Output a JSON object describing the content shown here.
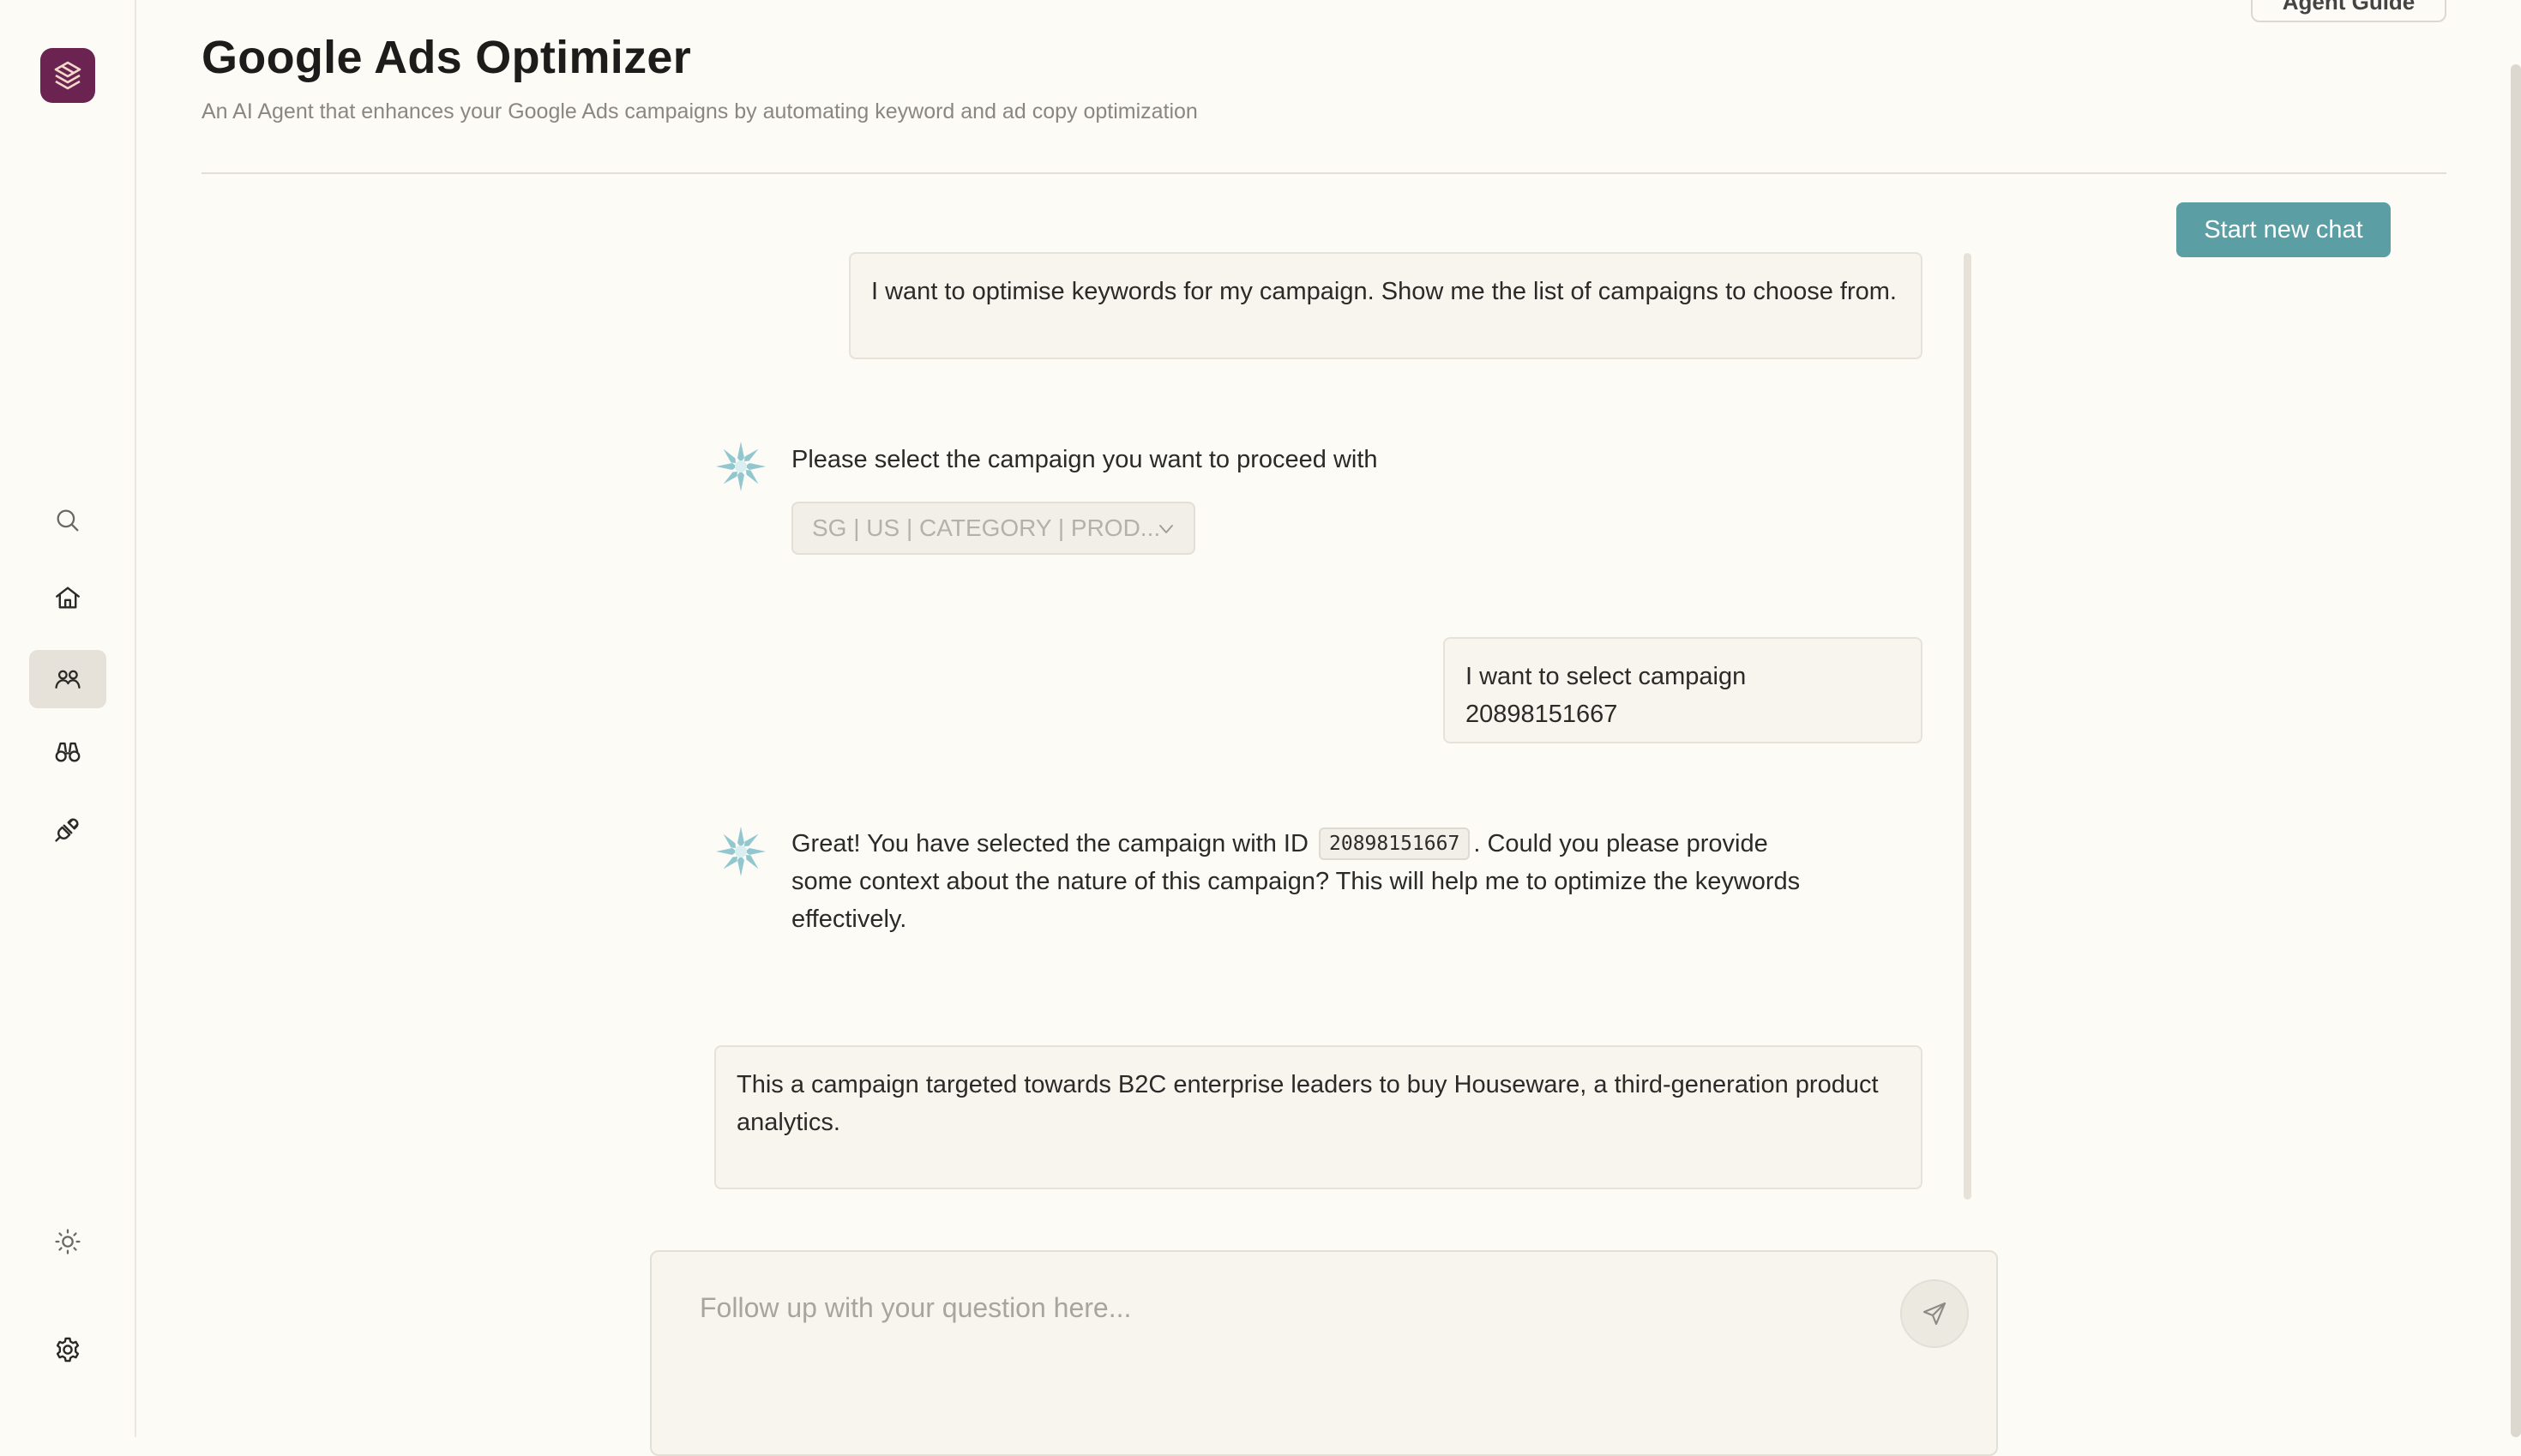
{
  "header": {
    "title": "Google Ads Optimizer",
    "subtitle": "An AI Agent that enhances your Google Ads campaigns by automating keyword and ad copy optimization",
    "agent_guide_label": "Agent Guide"
  },
  "toolbar": {
    "start_new_chat_label": "Start new chat"
  },
  "sidebar": {
    "items": [
      {
        "icon": "search-icon",
        "active": false
      },
      {
        "icon": "home-icon",
        "active": false
      },
      {
        "icon": "agents-icon",
        "active": true
      },
      {
        "icon": "binoculars-icon",
        "active": false
      },
      {
        "icon": "plug-icon",
        "active": false
      },
      {
        "icon": "sun-icon",
        "active": false
      },
      {
        "icon": "gear-icon",
        "active": false
      }
    ]
  },
  "chat": {
    "messages": [
      {
        "role": "user",
        "text": "I want to optimise keywords for my campaign. Show me the list of campaigns to choose from."
      },
      {
        "role": "assistant",
        "text": "Please select the campaign you want to proceed with",
        "select_value": "SG | US | CATEGORY | PROD..."
      },
      {
        "role": "user",
        "text": "I want to select campaign 20898151667"
      },
      {
        "role": "assistant",
        "text_before": "Great! You have selected the campaign with ID",
        "code": "20898151667",
        "text_after": ". Could you please provide some context about the nature of this campaign? This will help me to optimize the keywords effectively."
      },
      {
        "role": "user",
        "text": "This a campaign targeted towards B2C enterprise leaders to buy Houseware, a third-generation product analytics."
      }
    ]
  },
  "composer": {
    "placeholder": "Follow up with your question here...",
    "value": ""
  },
  "colors": {
    "background": "#fdfbf6",
    "accent": "#5b9ea4",
    "logo": "#6b2451",
    "bubble": "#f7f5ee"
  }
}
